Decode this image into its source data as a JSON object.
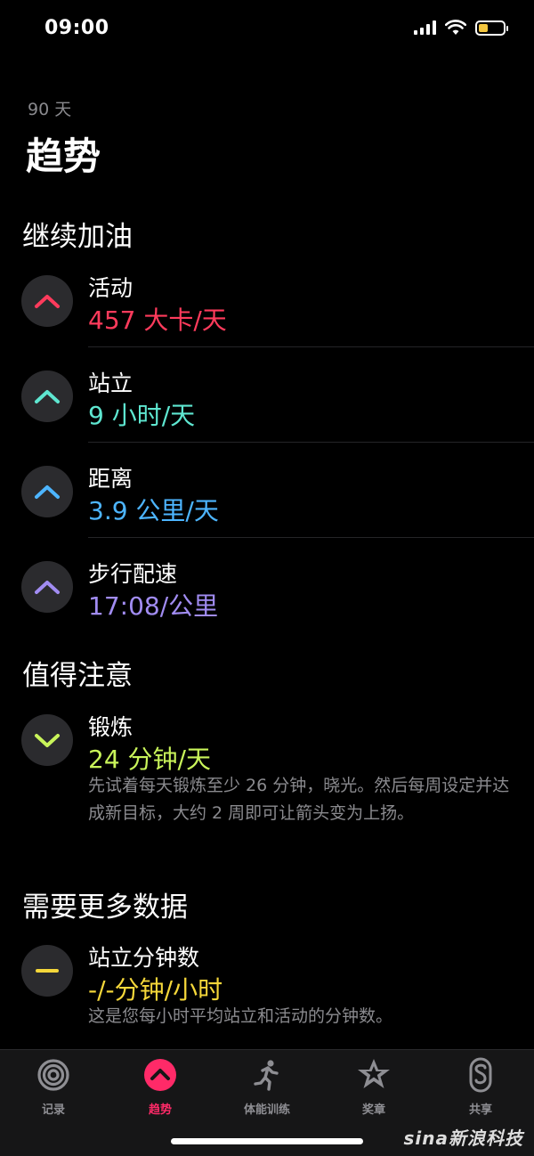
{
  "status_bar": {
    "time": "09:00"
  },
  "header": {
    "period": "90 天",
    "title": "趋势"
  },
  "sections": {
    "keep_going": {
      "title": "继续加油",
      "items": [
        {
          "label": "活动",
          "value": "457 大卡/天",
          "color": "#ff3b5c",
          "trend": "up"
        },
        {
          "label": "站立",
          "value": "9 小时/天",
          "color": "#5ee6d0",
          "trend": "up"
        },
        {
          "label": "距离",
          "value": "3.9 公里/天",
          "color": "#4db5ff",
          "trend": "up"
        },
        {
          "label": "步行配速",
          "value": "17:08/公里",
          "color": "#a18cf2",
          "trend": "up"
        }
      ]
    },
    "notable": {
      "title": "值得注意",
      "items": [
        {
          "label": "锻炼",
          "value": "24 分钟/天",
          "color": "#c9f45a",
          "trend": "down",
          "description": "先试着每天锻炼至少 26 分钟，晓光。然后每周设定并达成新目标，大约 2 周即可让箭头变为上扬。"
        }
      ]
    },
    "need_more": {
      "title": "需要更多数据",
      "items": [
        {
          "label": "站立分钟数",
          "value": "-/-分钟/小时",
          "color": "#f5d73a",
          "trend": "flat",
          "description": "这是您每小时平均站立和活动的分钟数。"
        }
      ]
    }
  },
  "tabs": [
    {
      "label": "记录",
      "icon": "activity-rings-icon",
      "active": false
    },
    {
      "label": "趋势",
      "icon": "trends-icon",
      "active": true
    },
    {
      "label": "体能训练",
      "icon": "running-figure-icon",
      "active": false
    },
    {
      "label": "奖章",
      "icon": "award-star-icon",
      "active": false
    },
    {
      "label": "共享",
      "icon": "sharing-icon",
      "active": false
    }
  ],
  "colors": {
    "active_tab": "#ff2a68",
    "inactive": "#8e8e93",
    "background": "#000000"
  },
  "watermark": "sina新浪科技"
}
